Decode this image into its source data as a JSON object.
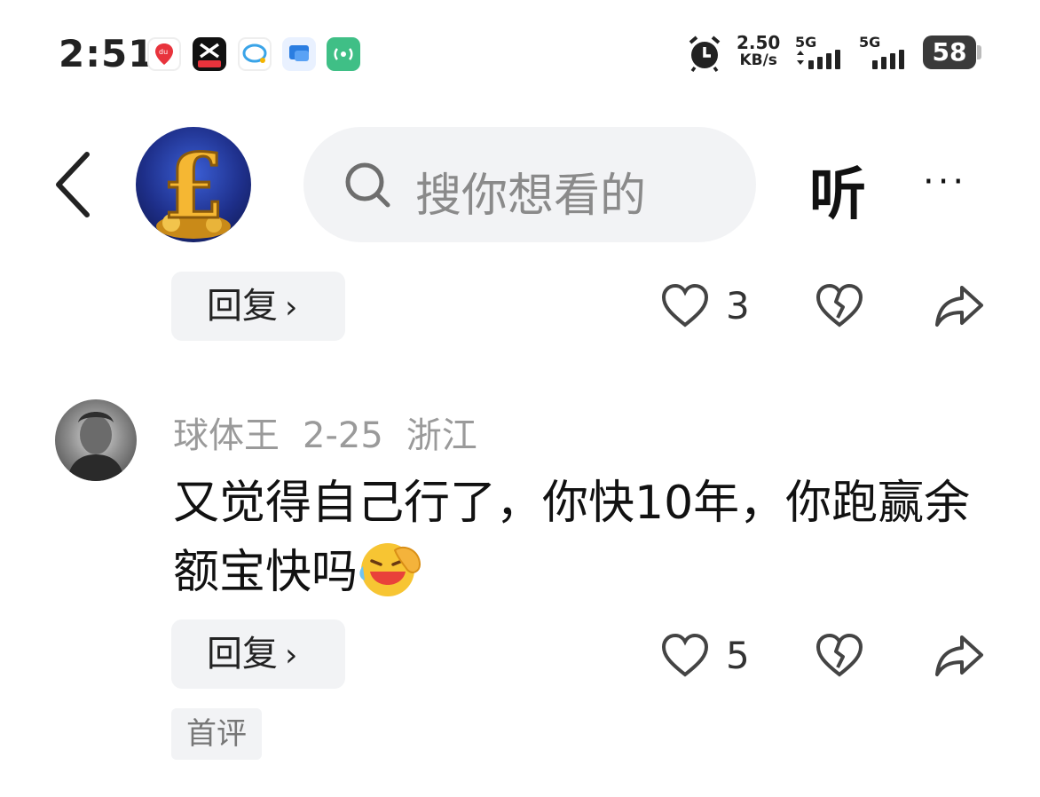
{
  "status_bar": {
    "time": "2:51",
    "apps": [
      "baidu-maps-icon",
      "capcut-icon",
      "chat-bubble-icon",
      "message-app-icon",
      "broadcast-app-icon"
    ],
    "net_speed_value": "2.50",
    "net_speed_unit": "KB/s",
    "sim1_label": "5G",
    "sim2_label": "5G",
    "battery": "58"
  },
  "header": {
    "search_placeholder": "搜你想看的",
    "listen_label": "听",
    "more_label": "···"
  },
  "prev_comment": {
    "reply_label": "回复",
    "like_count": "3"
  },
  "comment": {
    "username": "球体王",
    "date": "2-25",
    "location": "浙江",
    "text": "又觉得自己行了，你快10年，你跑赢余额宝快吗",
    "reply_label": "回复",
    "like_count": "5",
    "badge": "首评"
  },
  "colors": {
    "pill_bg": "#f2f3f5",
    "meta_text": "#9a9a9a",
    "primary_text": "#111111"
  }
}
